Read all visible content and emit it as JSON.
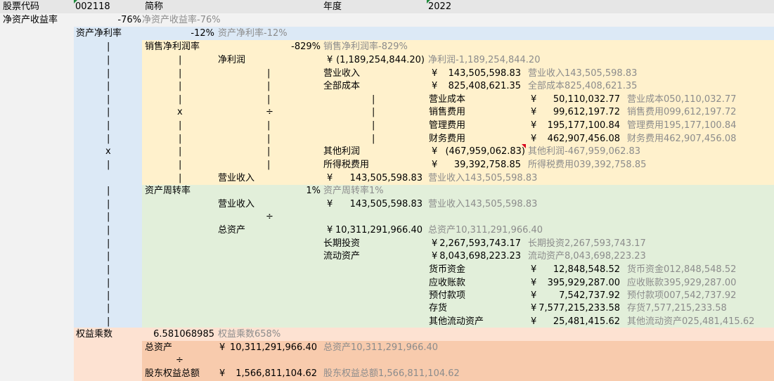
{
  "colors": {
    "header_bg": "#e6e6e6",
    "roe_bg": "#f2f2f2",
    "net_margin_bg": "#dce9f6",
    "sales_margin_bg": "#fff1cc",
    "turnover_bg": "#e2efda",
    "equity_mult_bg": "#fde2d2",
    "equity_detail_bg": "#f8cbad",
    "green_marker": "#1e8a3c",
    "red_marker": "#d9001b"
  },
  "header": {
    "code_label": "股票代码",
    "code_value": "002118",
    "name_label": "简称",
    "year_label": "年度",
    "year_value": "2022"
  },
  "roe": {
    "label": "净资产收益率",
    "value": "-76%",
    "desc": "净资产收益率-76%"
  },
  "net_margin": {
    "label": "资产净利率",
    "value": "-12%",
    "desc": "资产净利率-12%"
  },
  "sales_margin": {
    "label": "销售净利润率",
    "value": "-829%",
    "desc": "销售净利润率-829%"
  },
  "net_profit": {
    "label": "净利润",
    "currency": "¥",
    "value": "(1,189,254,844.20)",
    "desc": "净利润-1,189,254,844.20"
  },
  "revenue_a": {
    "label": "营业收入",
    "currency": "¥",
    "value": "143,505,598.83",
    "desc": "营业收入143,505,598.83"
  },
  "total_cost": {
    "label": "全部成本",
    "currency": "¥",
    "value": "825,408,621.35",
    "desc": "全部成本825,408,621.35"
  },
  "cost_items": [
    {
      "label": "营业成本",
      "currency": "¥",
      "value": "50,110,032.77",
      "desc": "营业成本050,110,032.77"
    },
    {
      "label": "销售费用",
      "currency": "¥",
      "value": "99,612,197.72",
      "desc": "销售费用099,612,197.72"
    },
    {
      "label": "管理费用",
      "currency": "¥",
      "value": "195,177,100.84",
      "desc": "管理费用195,177,100.84"
    },
    {
      "label": "财务费用",
      "currency": "¥",
      "value": "462,907,456.08",
      "desc": "财务费用462,907,456.08"
    }
  ],
  "other_profit": {
    "label": "其他利润",
    "currency": "¥",
    "value": "(467,959,062.83)",
    "desc": "其他利润-467,959,062.83"
  },
  "income_tax": {
    "label": "所得税费用",
    "currency": "¥",
    "value": "39,392,758.85",
    "desc": "所得税费用039,392,758.85"
  },
  "revenue_b": {
    "label": "营业收入",
    "currency": "¥",
    "value": "143,505,598.83",
    "desc": "营业收入143,505,598.83"
  },
  "turnover": {
    "label": "资产周转率",
    "value": "1%",
    "desc": "资产周转率1%"
  },
  "revenue_c": {
    "label": "营业收入",
    "currency": "¥",
    "value": "143,505,598.83",
    "desc": "营业收入143,505,598.83"
  },
  "total_assets": {
    "label": "总资产",
    "currency": "¥",
    "value": "10,311,291,966.40",
    "desc": "总资产10,311,291,966.40"
  },
  "long_invest": {
    "label": "长期投资",
    "currency": "¥",
    "value": "2,267,593,743.17",
    "desc": "长期投资2,267,593,743.17"
  },
  "current_assets": {
    "label": "流动资产",
    "currency": "¥",
    "value": "8,043,698,223.23",
    "desc": "流动资产8,043,698,223.23"
  },
  "current_items": [
    {
      "label": "货币资金",
      "currency": "¥",
      "value": "12,848,548.52",
      "desc": "货币资金012,848,548.52"
    },
    {
      "label": "应收账款",
      "currency": "¥",
      "value": "395,929,287.00",
      "desc": "应收账款395,929,287.00"
    },
    {
      "label": "预付款项",
      "currency": "¥",
      "value": "7,542,737.92",
      "desc": "预付款项007,542,737.92"
    },
    {
      "label": "存货",
      "currency": "¥",
      "value": "7,577,215,233.58",
      "desc": "存货7,577,215,233.58"
    },
    {
      "label": "其他流动资产",
      "currency": "¥",
      "value": "25,481,415.62",
      "desc": "其他流动资产025,481,415.62"
    }
  ],
  "equity_mult": {
    "label": "权益乘数",
    "value": "6.581068985",
    "desc": "权益乘数658%"
  },
  "total_assets_b": {
    "label": "总资产",
    "currency": "¥",
    "value": "10,311,291,966.40",
    "desc": "总资产10,311,291,966.40"
  },
  "equity": {
    "label": "股东权益总额",
    "currency": "¥",
    "value": "1,566,811,104.62",
    "desc": "股东权益总额1,566,811,104.62"
  },
  "symbols": {
    "pipe": "|",
    "times": "x",
    "divide": "÷"
  }
}
